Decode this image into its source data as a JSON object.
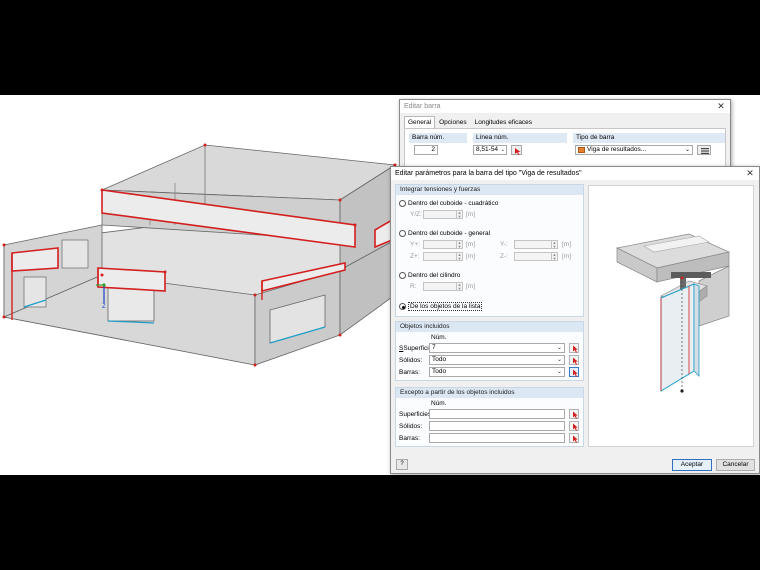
{
  "back_dialog": {
    "title": "Editar barra",
    "tabs": [
      "General",
      "Opciones",
      "Longitudes eficaces"
    ],
    "member_no_label": "Barra núm.",
    "member_no_value": "2",
    "line_no_label": "Línea núm.",
    "line_no_value": "8,51-54",
    "member_type_label": "Tipo de barra",
    "member_type_value": "Viga de resultados..."
  },
  "dialog": {
    "title": "Editar parámetros para la barra del tipo \"Viga de resultados\"",
    "section_integrate": "Integrar tensiones y fuerzas",
    "options": {
      "cuboid_quadratic": "Dentro del cuboide - cuadrático",
      "cuboid_general": "Dentro del cuboide - general",
      "cylinder": "Dentro del cilindro",
      "from_list": "De los objetos de la lista"
    },
    "selected_option": "from_list",
    "params": {
      "yz": "Y/Z:",
      "y_plus": "Y+:",
      "y_minus": "Y-:",
      "z_plus": "Z+:",
      "z_minus": "Z-:",
      "r": "R:",
      "unit_m": "[m]"
    },
    "section_included": "Objetos incluidos",
    "num_label": "Núm.",
    "surfaces_label": "Superficies:",
    "solids_label": "Sólidos:",
    "members_label": "Barras:",
    "included_surfaces": "7",
    "included_solids": "Todo",
    "included_members": "Todo",
    "section_except": "Excepto a partir de los objetos incluidos",
    "except_num_label": "Núm.",
    "except_surfaces_label": "Superficies:",
    "except_solids_label": "Sólidos:",
    "except_members_label": "Barras:",
    "ok_label": "Aceptar",
    "cancel_label": "Cancelar"
  },
  "colors": {
    "accent_red": "#d41f1f",
    "panel_header": "#dce7f4",
    "result_beam_cyan": "#1e9fc8"
  },
  "icons": [
    "close-icon",
    "chevron-down-icon",
    "pick-object-icon",
    "help-icon",
    "spin-arrows-icon"
  ],
  "viewport": {
    "axis_label": "Z"
  }
}
